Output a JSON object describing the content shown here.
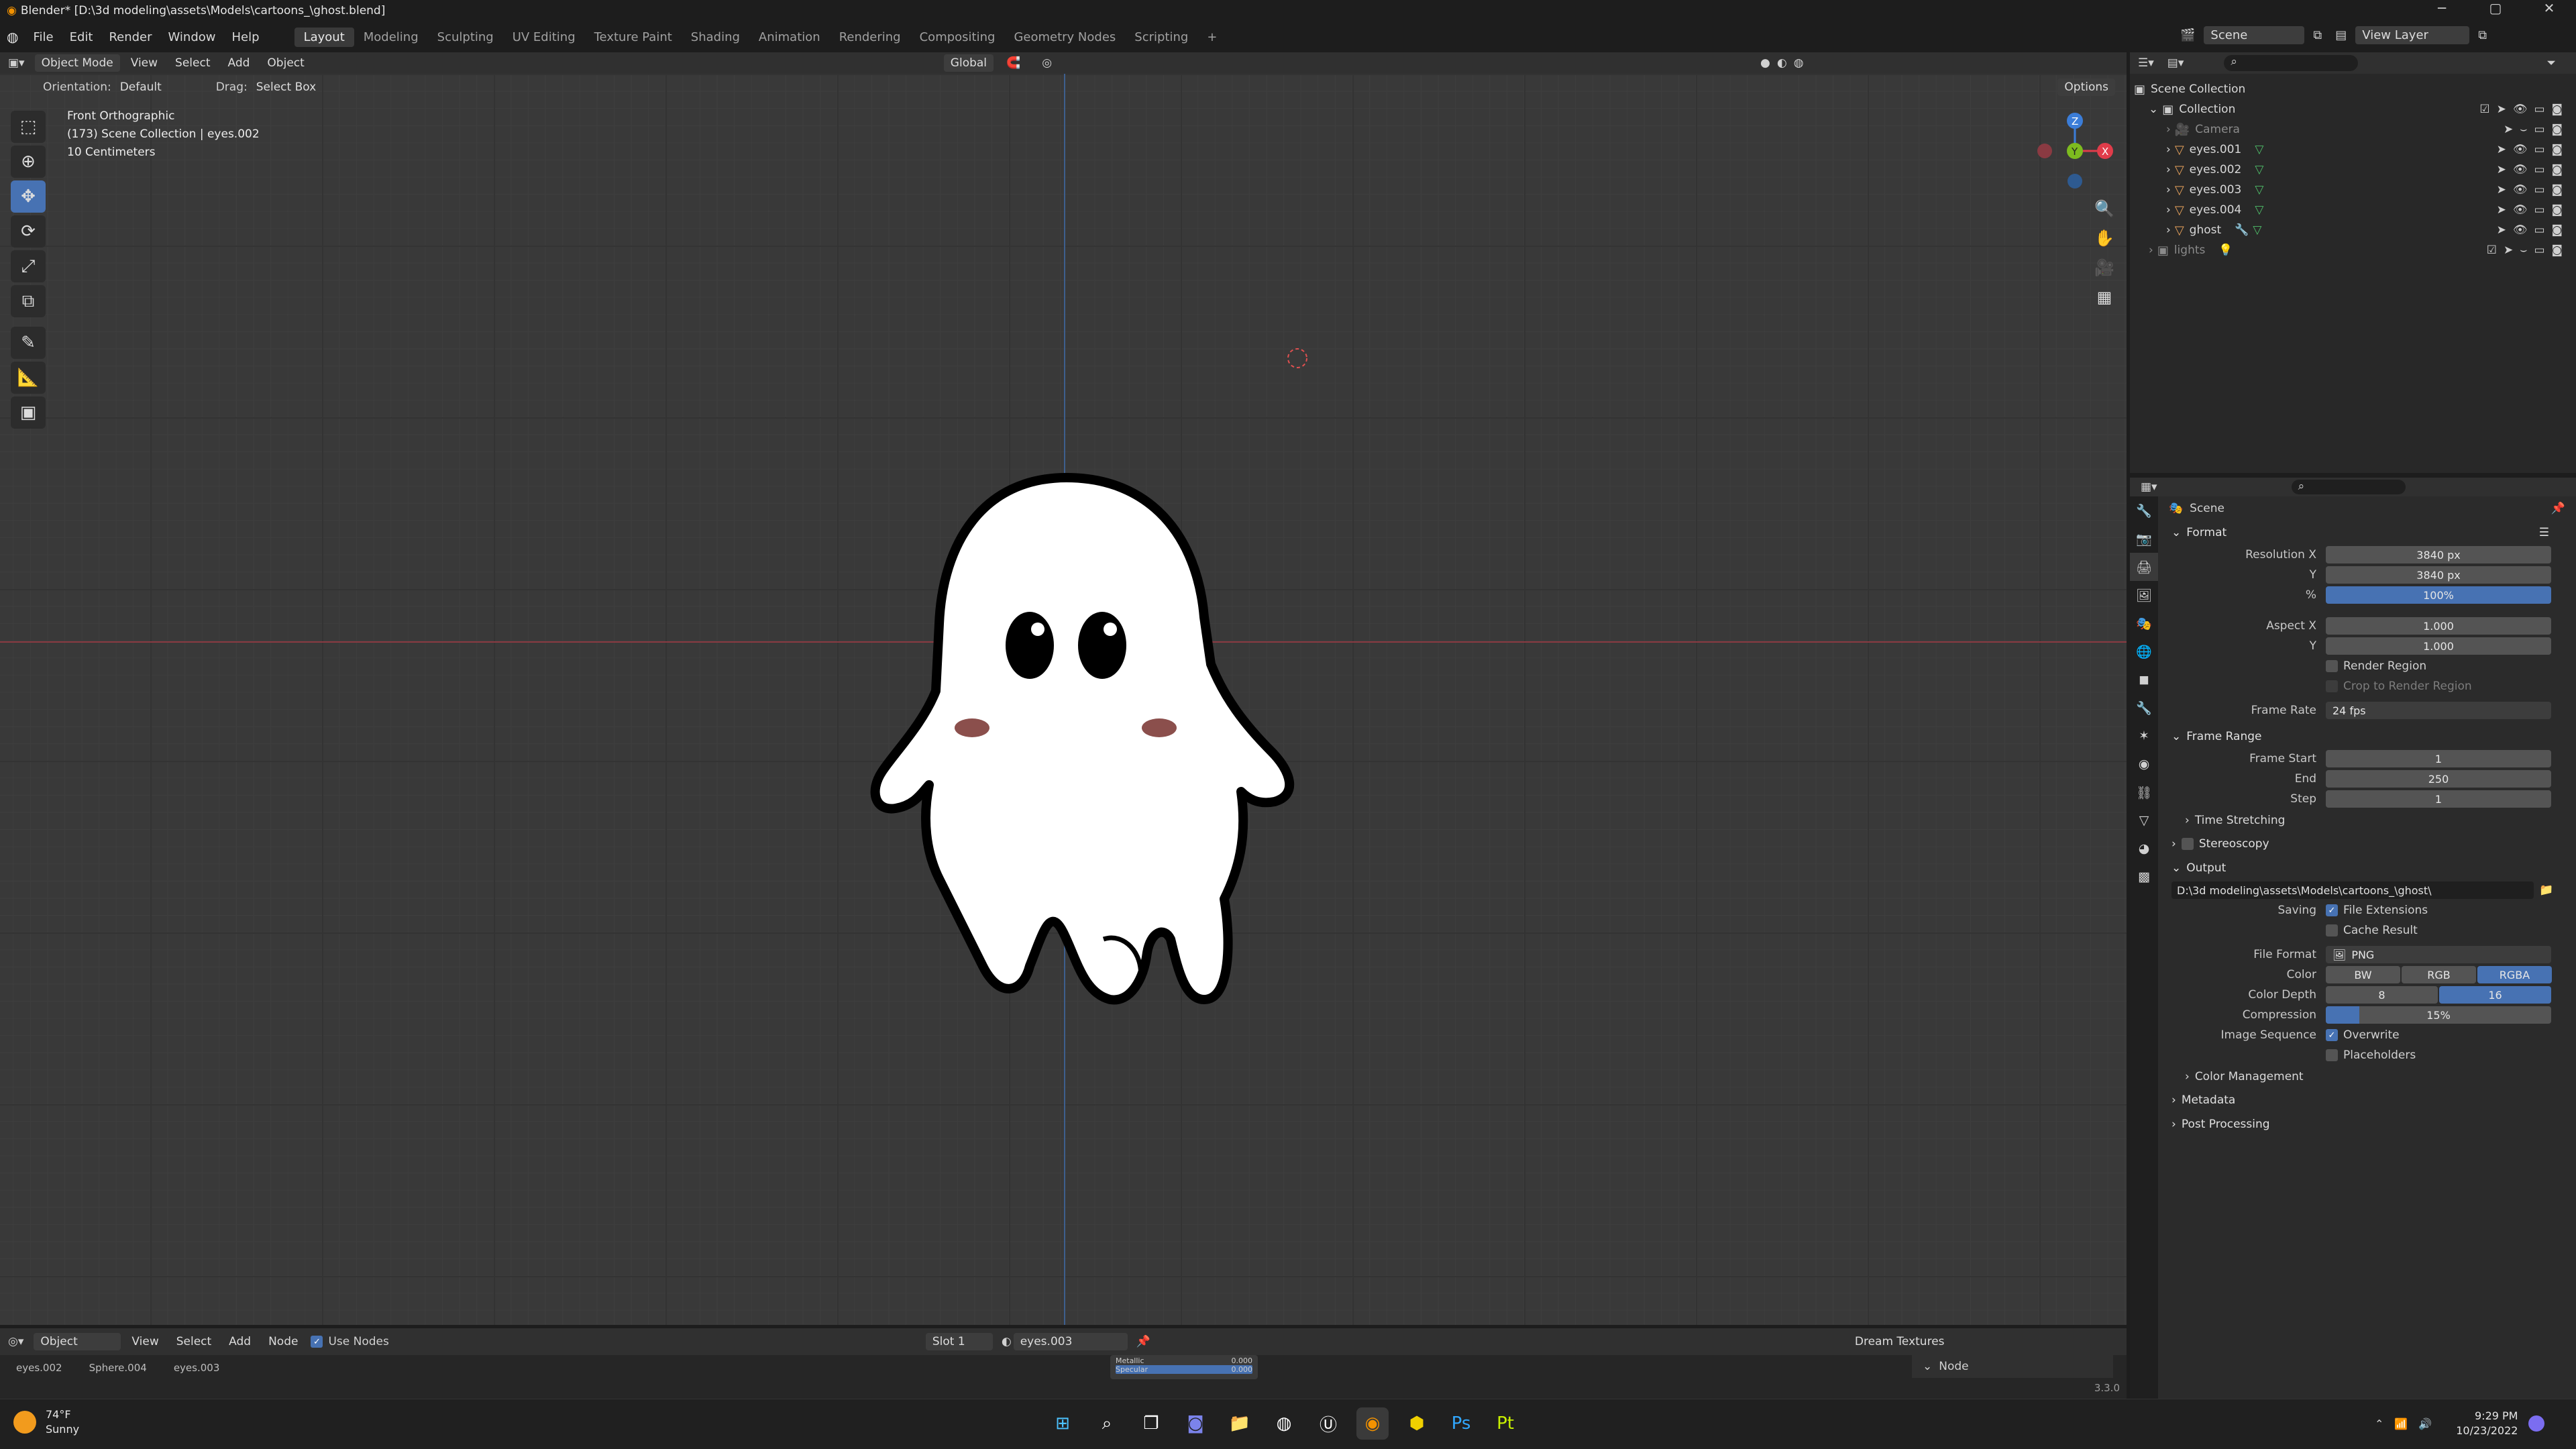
{
  "titlebar": {
    "title": "Blender* [D:\\3d modeling\\assets\\Models\\cartoons_\\ghost.blend]",
    "min": "─",
    "max": "▢",
    "close": "✕"
  },
  "menubar": {
    "menus": [
      "File",
      "Edit",
      "Render",
      "Window",
      "Help"
    ],
    "workspaces": [
      "Layout",
      "Modeling",
      "Sculpting",
      "UV Editing",
      "Texture Paint",
      "Shading",
      "Animation",
      "Rendering",
      "Compositing",
      "Geometry Nodes",
      "Scripting"
    ],
    "add_tab": "+",
    "scene": "Scene",
    "view_layer": "View Layer"
  },
  "viewport_header": {
    "mode": "Object Mode",
    "menus": [
      "View",
      "Select",
      "Add",
      "Object"
    ],
    "transform_orientation": "Global",
    "orientation_label": "Orientation:",
    "orientation_value": "Default",
    "drag_label": "Drag:",
    "drag_value": "Select Box",
    "options": "Options"
  },
  "viewport_info": {
    "view": "Front Orthographic",
    "collection": "(173) Scene Collection | eyes.002",
    "scale": "10 Centimeters"
  },
  "outliner": {
    "root": "Scene Collection",
    "items": [
      {
        "label": "Collection",
        "indent": 1
      },
      {
        "label": "Camera",
        "indent": 2
      },
      {
        "label": "eyes.001",
        "indent": 2
      },
      {
        "label": "eyes.002",
        "indent": 2
      },
      {
        "label": "eyes.003",
        "indent": 2
      },
      {
        "label": "eyes.004",
        "indent": 2
      },
      {
        "label": "ghost",
        "indent": 2
      },
      {
        "label": "lights",
        "indent": 1
      }
    ]
  },
  "properties": {
    "context": "Scene",
    "format": {
      "title": "Format",
      "resolution_x_label": "Resolution X",
      "resolution_x": "3840 px",
      "y_label": "Y",
      "resolution_y": "3840 px",
      "percent_label": "%",
      "percent": "100%",
      "aspect_x_label": "Aspect X",
      "aspect_x": "1.000",
      "aspect_y_label": "Y",
      "aspect_y": "1.000",
      "render_region": "Render Region",
      "crop_region": "Crop to Render Region",
      "frame_rate_label": "Frame Rate",
      "frame_rate": "24 fps"
    },
    "frame_range": {
      "title": "Frame Range",
      "start_label": "Frame Start",
      "start": "1",
      "end_label": "End",
      "end": "250",
      "step_label": "Step",
      "step": "1",
      "time_stretching": "Time Stretching"
    },
    "stereoscopy": "Stereoscopy",
    "output": {
      "title": "Output",
      "path": "D:\\3d modeling\\assets\\Models\\cartoons_\\ghost\\",
      "saving_label": "Saving",
      "file_extensions": "File Extensions",
      "cache_result": "Cache Result",
      "file_format_label": "File Format",
      "file_format": "PNG",
      "color_label": "Color",
      "color_options": [
        "BW",
        "RGB",
        "RGBA"
      ],
      "color_depth_label": "Color Depth",
      "color_depth_options": [
        "8",
        "16"
      ],
      "compression_label": "Compression",
      "compression": "15%",
      "compression_value": 0.15,
      "image_sequence_label": "Image Sequence",
      "overwrite": "Overwrite",
      "placeholders": "Placeholders",
      "color_management": "Color Management"
    },
    "metadata": "Metadata",
    "post_processing": "Post Processing"
  },
  "node_editor": {
    "object": "Object",
    "menus": [
      "View",
      "Select",
      "Add",
      "Node"
    ],
    "use_nodes": "Use Nodes",
    "slot": "Slot 1",
    "material": "eyes.003",
    "dream_textures": "Dream Textures",
    "node_panel": "Node",
    "mini_labels": [
      "Metallic",
      "Specular"
    ],
    "mini_values": [
      "0.000",
      "0.000"
    ]
  },
  "breadcrumbs": [
    "eyes.002",
    "Sphere.004",
    "eyes.003"
  ],
  "version": "3.3.0",
  "taskbar": {
    "temp": "74°F",
    "weather": "Sunny",
    "time": "9:29 PM",
    "date": "10/23/2022"
  },
  "colors": {
    "accent": "#4772b3",
    "ghost_outline": "#000000",
    "cheek": "#8b4f4c",
    "x_axis": "#e03c4a",
    "y_axis": "#7dbb1f",
    "z_axis": "#3b7dd8"
  }
}
